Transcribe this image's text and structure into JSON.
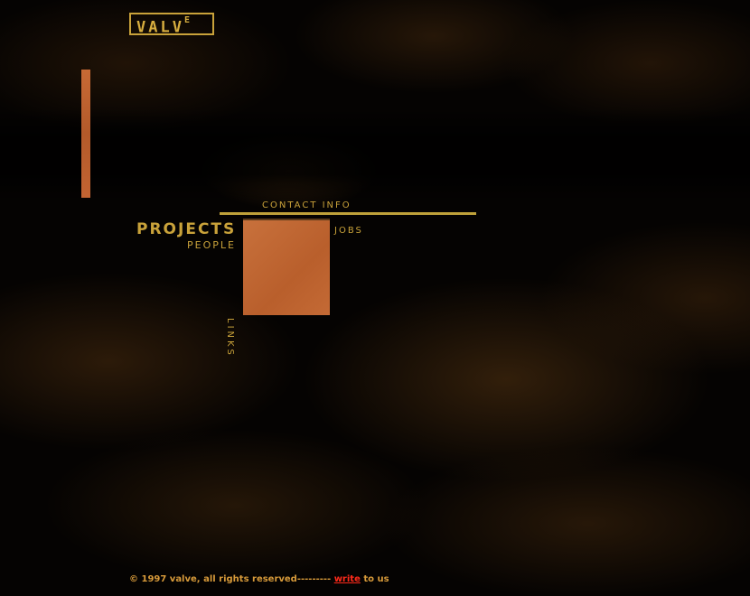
{
  "brand": {
    "logo_text": "VALV",
    "logo_sup": "E"
  },
  "nav": {
    "contact": "CONTACT INFO",
    "projects": "PROJECTS",
    "people": "PEOPLE",
    "jobs": "JOBS",
    "links": "LINKS"
  },
  "footer": {
    "copyright": "© 1997 valve, all rights reserved---------",
    "write_link": "write",
    "suffix": "to us"
  },
  "colors": {
    "gold": "#c9a23a",
    "rust": "#c2662f",
    "link_red": "#ff2a1a",
    "background": "#000000"
  }
}
